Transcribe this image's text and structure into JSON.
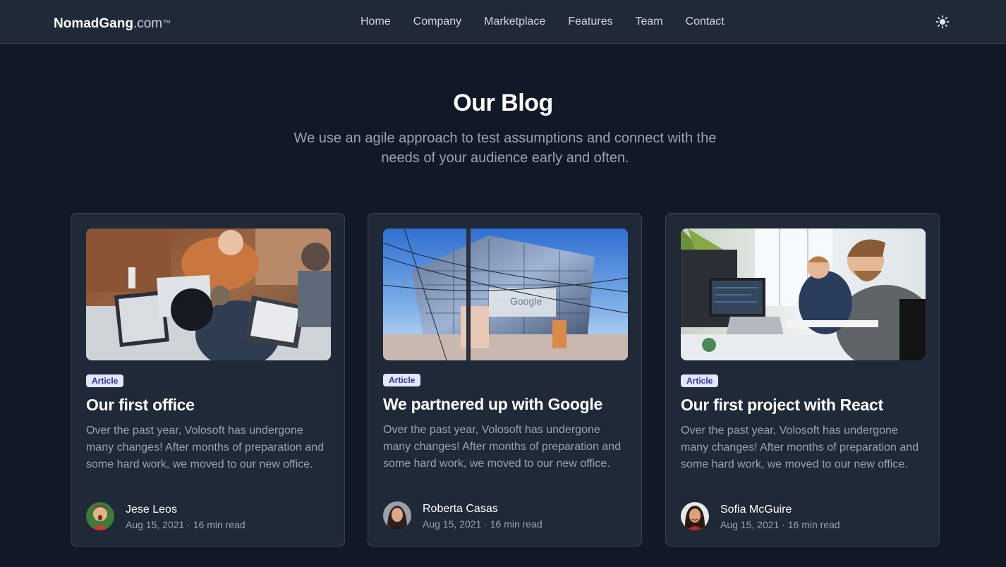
{
  "navbar": {
    "brand_strong": "NomadGang",
    "brand_light": ".com",
    "brand_tm": "TM",
    "links": [
      "Home",
      "Company",
      "Marketplace",
      "Features",
      "Team",
      "Contact"
    ],
    "theme_icon": "sun-icon"
  },
  "hero": {
    "title": "Our Blog",
    "subtitle": "We use an agile approach to test assumptions and connect with the needs of your audience early and often."
  },
  "posts": [
    {
      "badge": "Article",
      "title": "Our first office",
      "excerpt": "Over the past year, Volosoft has undergone many changes! After months of preparation and some hard work, we moved to our new office.",
      "author": "Jese Leos",
      "meta": "Aug 15, 2021 · 16 min read"
    },
    {
      "badge": "Article",
      "title": "We partnered up with Google",
      "excerpt": "Over the past year, Volosoft has undergone many changes! After months of preparation and some hard work, we moved to our new office.",
      "author": "Roberta Casas",
      "meta": "Aug 15, 2021 · 16 min read"
    },
    {
      "badge": "Article",
      "title": "Our first project with React",
      "excerpt": "Over the past year, Volosoft has undergone many changes! After months of preparation and some hard work, we moved to our new office.",
      "author": "Sofia McGuire",
      "meta": "Aug 15, 2021 · 16 min read"
    }
  ],
  "colors": {
    "background": "#111827",
    "card": "#1f2937",
    "border": "#374151",
    "badge_bg": "#e0e7ff",
    "badge_text": "#3730a3"
  }
}
